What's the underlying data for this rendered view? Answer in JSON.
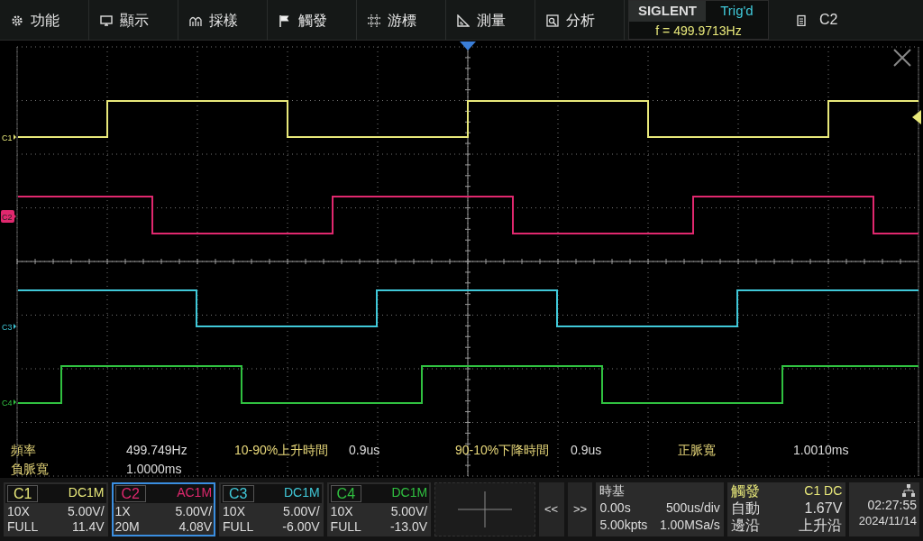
{
  "menu": [
    {
      "label": "功能"
    },
    {
      "label": "顯示"
    },
    {
      "label": "採樣"
    },
    {
      "label": "觸發"
    },
    {
      "label": "游標"
    },
    {
      "label": "測量"
    },
    {
      "label": "分析"
    }
  ],
  "brand": "SIGLENT",
  "trigger_status": "Trig'd",
  "frequency": "f = 499.9713Hz",
  "active_channel": "C2",
  "traces": [
    {
      "label": "C1",
      "color": "#e8e87a",
      "selected": false
    },
    {
      "label": "C2",
      "color": "#e0286e",
      "selected": true
    },
    {
      "label": "C3",
      "color": "#40c8d8",
      "selected": false
    },
    {
      "label": "C4",
      "color": "#30c040",
      "selected": false
    }
  ],
  "measurements": [
    {
      "name": "頻率",
      "value": "499.749Hz"
    },
    {
      "name": "10-90%上升時間",
      "value": "0.9us"
    },
    {
      "name": "90-10%下降時間",
      "value": "0.9us"
    },
    {
      "name": "正脈寬",
      "value": "1.0010ms"
    },
    {
      "name": "負脈寬",
      "value": "1.0000ms"
    }
  ],
  "channels": [
    {
      "name": "C1",
      "coupling": "DC1M",
      "probe": "10X",
      "scale": "5.00V/",
      "bandwidth": "FULL",
      "offset": "11.4V",
      "color": "#e8e87a",
      "selected": false
    },
    {
      "name": "C2",
      "coupling": "AC1M",
      "probe": "1X",
      "scale": "5.00V/",
      "bandwidth": "20M",
      "offset": "4.08V",
      "color": "#e0286e",
      "selected": true
    },
    {
      "name": "C3",
      "coupling": "DC1M",
      "probe": "10X",
      "scale": "5.00V/",
      "bandwidth": "FULL",
      "offset": "-6.00V",
      "color": "#40c8d8",
      "selected": false
    },
    {
      "name": "C4",
      "coupling": "DC1M",
      "probe": "10X",
      "scale": "5.00V/",
      "bandwidth": "FULL",
      "offset": "-13.0V",
      "color": "#30c040",
      "selected": false
    }
  ],
  "nav": [
    "<<",
    ">>"
  ],
  "timebase": {
    "title": "時基",
    "delay": "0.00s",
    "scale": "500us/div",
    "points": "5.00kpts",
    "rate": "1.00MSa/s"
  },
  "trigger": {
    "title": "觸發",
    "source": "C1 DC",
    "mode": "自動",
    "level": "1.67V",
    "type": "邊沿",
    "slope": "上升沿"
  },
  "clock": {
    "time": "02:27:55",
    "date": "2024/11/14"
  }
}
